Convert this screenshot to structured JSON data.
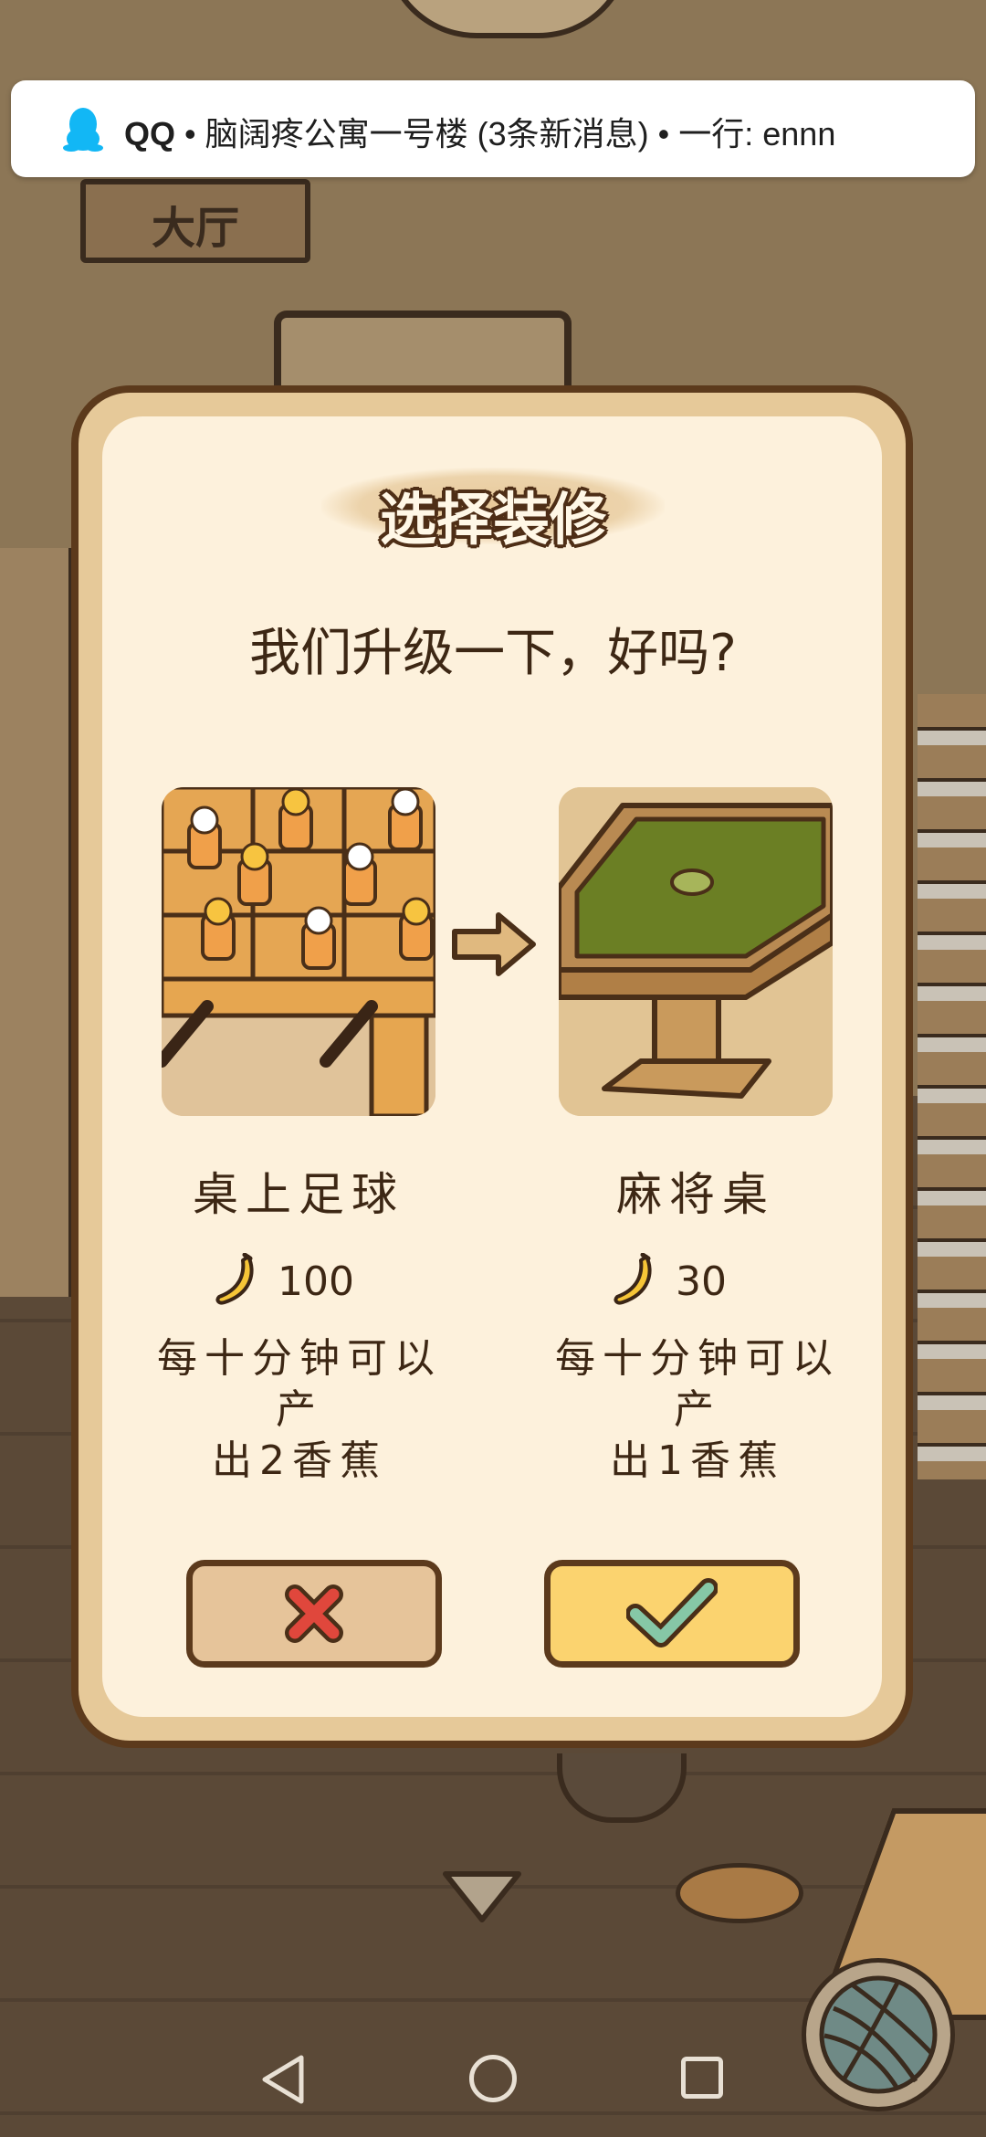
{
  "notification": {
    "app": "QQ",
    "separator1": " • ",
    "group": "脑阔疼公寓一号楼 (3条新消息)",
    "separator2": " • ",
    "sender_message": "一行: ennn",
    "icon": "qq-penguin-icon"
  },
  "scene": {
    "room_sign": "大厅"
  },
  "dialog": {
    "title": "选择装修",
    "question": "我们升级一下，好吗?",
    "current": {
      "name": "桌上足球",
      "price": "100",
      "description_line1": "每十分钟可以产",
      "description_line2": "出2香蕉",
      "image": "foosball-table-image"
    },
    "upgrade": {
      "name": "麻将桌",
      "price": "30",
      "description_line1": "每十分钟可以产",
      "description_line2": "出1香蕉",
      "image": "mahjong-table-image"
    },
    "cancel_icon": "x-icon",
    "confirm_icon": "check-icon"
  },
  "colors": {
    "dialog_border": "#5c3a1c",
    "dialog_bg": "#fdf1dc",
    "cancel_bg": "#e6c49a",
    "confirm_bg": "#fbd36f",
    "cancel_icon": "#e0473c",
    "confirm_icon": "#86c7a6"
  },
  "navbar": {
    "back": "back-icon",
    "home": "home-icon",
    "recent": "recent-apps-icon"
  }
}
